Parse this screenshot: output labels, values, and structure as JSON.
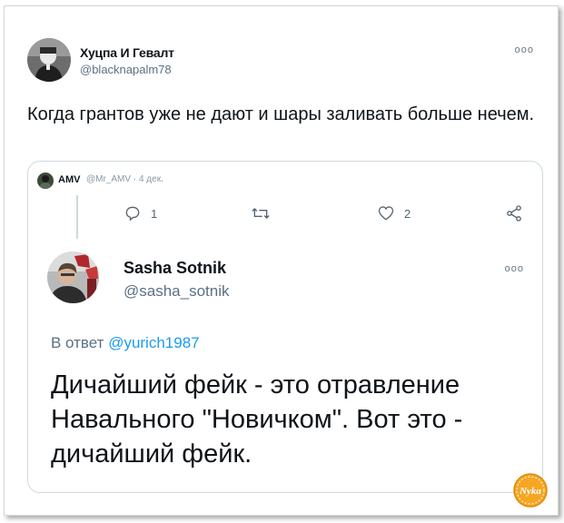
{
  "tweet": {
    "author_name": "Хуцпа И Гевалт",
    "author_handle": "@blacknapalm78",
    "more": "ooo",
    "text": "Когда грантов уже не дают и шары заливать больше нечем."
  },
  "quoted": {
    "name": "AMV",
    "handle": "@Mr_AMV",
    "separator": "·",
    "date": "4 дек.",
    "actions": {
      "reply_count": "1",
      "retweet_count": "",
      "like_count": "2"
    },
    "inner": {
      "name": "Sasha Sotnik",
      "handle": "@sasha_sotnik",
      "more": "ooo",
      "reply_prefix": "В ответ",
      "reply_to": "@yurich1987",
      "text": "Дичайший фейк - это отравление Навального \"Новичком\". Вот это - дичайший фейк."
    }
  },
  "watermark": {
    "text": "Nyka",
    "color": "#f5a623"
  },
  "colors": {
    "accent": "#1d9bf0",
    "secondary_text": "#5b7083",
    "border": "#cfd9de"
  }
}
